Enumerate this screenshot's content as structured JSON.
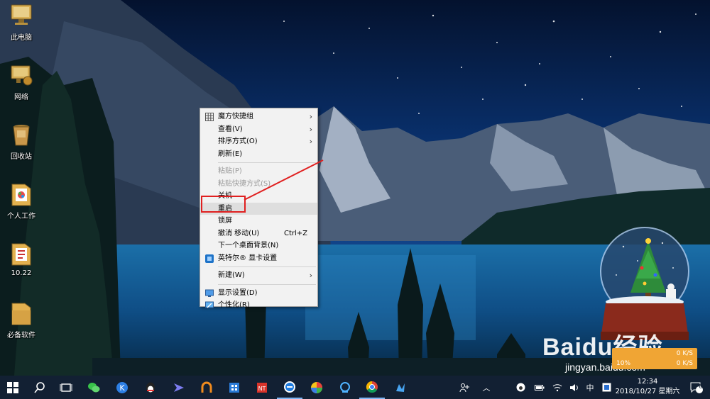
{
  "desktop": {
    "icons": [
      {
        "label": "此电脑",
        "icon": "computer-icon"
      },
      {
        "label": "网络",
        "icon": "network-icon"
      },
      {
        "label": "回收站",
        "icon": "recycle-bin-icon"
      },
      {
        "label": "个人工作",
        "icon": "folder-icon"
      },
      {
        "label": "10.22",
        "icon": "folder-icon"
      },
      {
        "label": "必备软件",
        "icon": "folder-icon"
      }
    ]
  },
  "context_menu": {
    "items": [
      {
        "label": "魔方快捷组",
        "submenu": true,
        "icon": "grid-icon"
      },
      {
        "label": "查看(V)",
        "submenu": true
      },
      {
        "label": "排序方式(O)",
        "submenu": true
      },
      {
        "label": "刷新(E)"
      },
      {
        "label": "粘贴(P)",
        "disabled": true
      },
      {
        "label": "粘贴快捷方式(S)",
        "disabled": true
      },
      {
        "label": "关机"
      },
      {
        "label": "重启",
        "highlighted": true
      },
      {
        "label": "锁屏"
      },
      {
        "label": "撤消 移动(U)",
        "shortcut": "Ctrl+Z"
      },
      {
        "label": "下一个桌面背景(N)"
      },
      {
        "label": "英特尔® 显卡设置",
        "icon": "intel-graphics-icon"
      },
      {
        "label": "新建(W)",
        "submenu": true
      },
      {
        "label": "显示设置(D)",
        "icon": "display-icon"
      },
      {
        "label": "个性化(R)",
        "icon": "personalize-icon"
      }
    ]
  },
  "watermark": {
    "logo": "Baidu经验",
    "url": "jingyan.baidu.com"
  },
  "net_widget": {
    "percent": "10%",
    "up": "0 K/S",
    "down": "0 K/S"
  },
  "taskbar": {
    "apps": [
      "start-icon",
      "search-icon",
      "task-view-icon",
      "wechat-icon",
      "k-app-icon",
      "qq-icon",
      "bird-app-icon",
      "horseshoe-app-icon",
      "store-app-icon",
      "nt-app-icon",
      "edge-icon",
      "color-wheel-icon",
      "qq-tim-icon",
      "chrome-icon",
      "dragon-app-icon"
    ],
    "tray": {
      "ime": "中",
      "time": "12:34",
      "date": "2018/10/27 星期六",
      "notifications": "6"
    }
  },
  "colors": {
    "menu_bg": "#f2f2f2",
    "highlight_box": "#e02020",
    "taskbar": "#122033"
  }
}
